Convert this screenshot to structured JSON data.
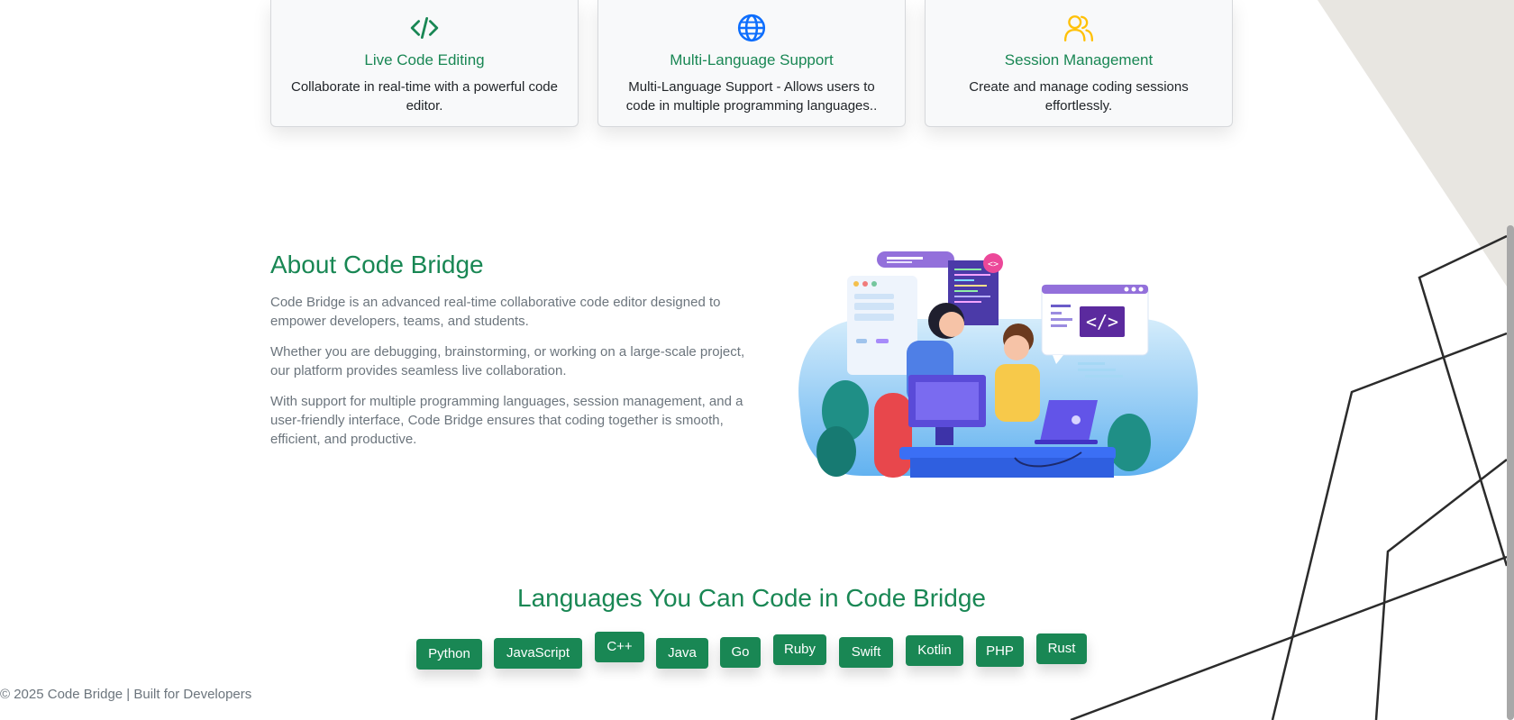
{
  "features": [
    {
      "title": "Live Code Editing",
      "desc": "Collaborate in real-time with a powerful code editor.",
      "icon": "code-icon",
      "icon_color": "#198754"
    },
    {
      "title": "Multi-Language Support",
      "desc": "Multi-Language Support - Allows users to code in multiple programming languages..",
      "icon": "globe-icon",
      "icon_color": "#0d6efd"
    },
    {
      "title": "Session Management",
      "desc": "Create and manage coding sessions effortlessly.",
      "icon": "users-icon",
      "icon_color": "#ffc107"
    }
  ],
  "about": {
    "title": "About Code Bridge",
    "p1": "Code Bridge is an advanced real-time collaborative code editor designed to empower developers, teams, and students.",
    "p2": "Whether you are debugging, brainstorming, or working on a large-scale project, our platform provides seamless live collaboration.",
    "p3": "With support for multiple programming languages, session management, and a user-friendly interface, Code Bridge ensures that coding together is smooth, efficient, and productive."
  },
  "languages": {
    "title": "Languages You Can Code in Code Bridge",
    "items": [
      "Python",
      "JavaScript",
      "C++",
      "Java",
      "Go",
      "Ruby",
      "Swift",
      "Kotlin",
      "PHP",
      "Rust"
    ]
  },
  "footer": {
    "text": "© 2025 Code Bridge | Built for Developers"
  },
  "colors": {
    "accent": "#198754",
    "text_muted": "#6c757d",
    "card_bg": "#f8f9fa"
  }
}
